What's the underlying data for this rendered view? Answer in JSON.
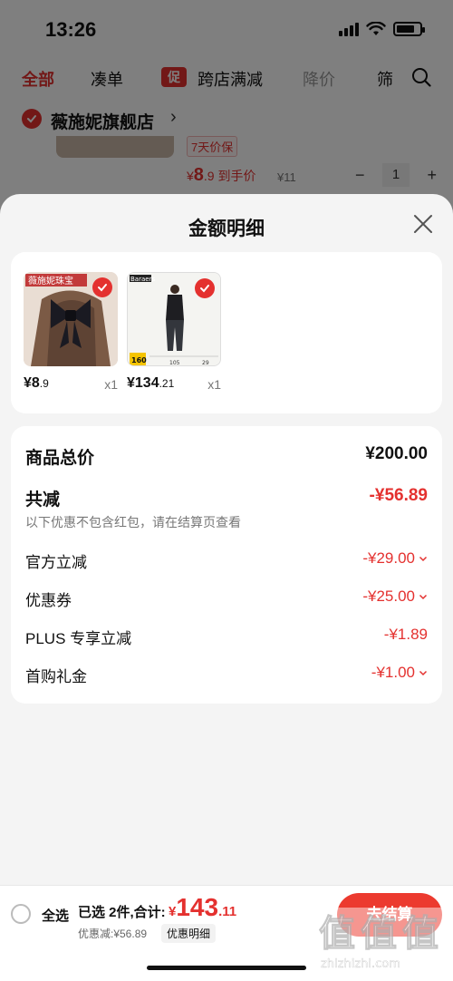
{
  "status_bar": {
    "time": "13:26"
  },
  "tabs": [
    {
      "label": "全部",
      "active": true
    },
    {
      "label": "凑单"
    },
    {
      "badge": "促",
      "label": "跨店满减"
    },
    {
      "label": "降价"
    },
    {
      "label": "筛"
    }
  ],
  "shop": {
    "name": "薇施妮旗舰店",
    "chevron": "›"
  },
  "bg_product": {
    "tag": "7天价保",
    "price_symbol": "¥",
    "price_int": "8",
    "price_dec": ".9",
    "price_suffix": " 到手价",
    "orig_price": "¥11",
    "qty": "1",
    "minus": "−",
    "plus": "+"
  },
  "sheet": {
    "title": "金额明细",
    "products": [
      {
        "image": "hair-bow-photo",
        "image_label": "薇施妮珠宝",
        "price_int": "¥8",
        "price_dec": ".9",
        "qty": "x1"
      },
      {
        "image": "pants-photo",
        "image_label": "Baraers",
        "price_int": "¥134",
        "price_dec": ".21",
        "qty": "x1"
      }
    ],
    "summary": {
      "total_label": "商品总价",
      "total_value": "¥200.00",
      "discount_label": "共减",
      "discount_value": "-¥56.89",
      "note": "以下优惠不包含红包，请在结算页查看",
      "items": [
        {
          "label": "官方立减",
          "value": "-¥29.00",
          "expandable": true
        },
        {
          "label": "优惠券",
          "value": "-¥25.00",
          "expandable": true
        },
        {
          "label": "PLUS 专享立减",
          "value": "-¥1.89",
          "expandable": false
        },
        {
          "label": "首购礼金",
          "value": "-¥1.00",
          "expandable": true
        }
      ]
    }
  },
  "bottom_bar": {
    "select_all": "全选",
    "selected_text": "已选 2件,合计:",
    "total_yen": "¥",
    "total_int": "143",
    "total_dec": ".11",
    "discount_text": "优惠减:¥56.89",
    "detail_link": "优惠明细",
    "checkout": "去结算"
  },
  "watermark": {
    "text": "值",
    "domain": "zhizhizhi.com"
  },
  "colors": {
    "accent": "#e4312f",
    "checkout": "#ec3a2f",
    "sheet_bg": "#f4f4f4"
  }
}
